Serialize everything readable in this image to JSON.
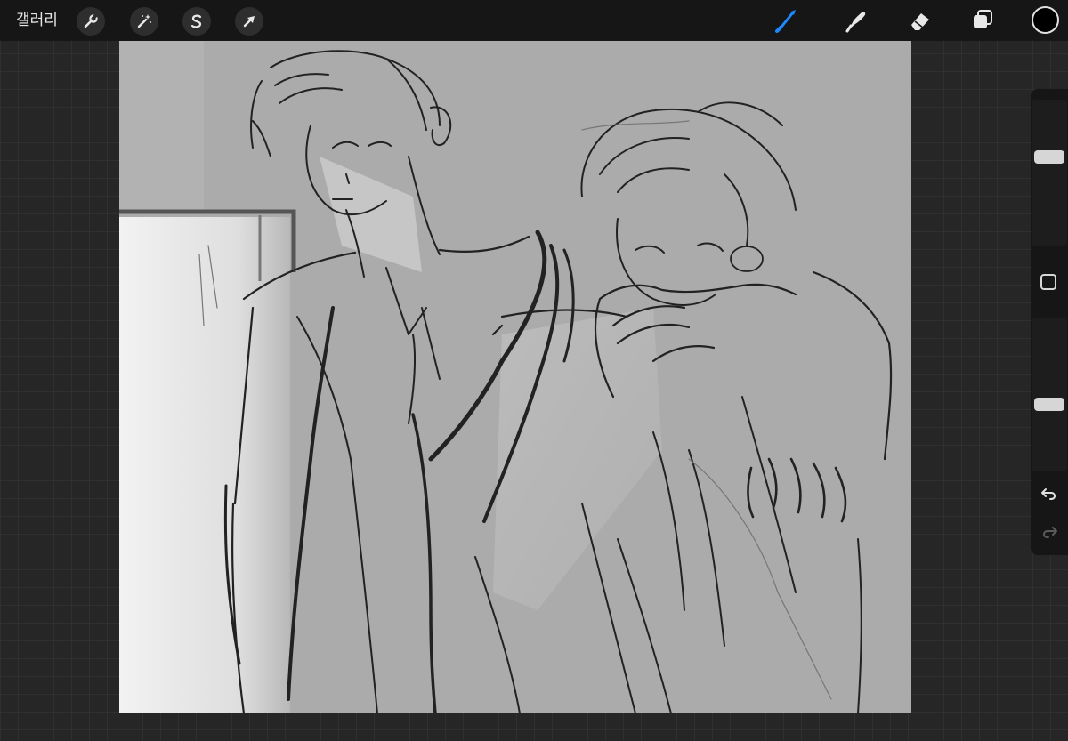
{
  "topbar": {
    "gallery_label": "갤러리",
    "actions_icon": "wrench-icon",
    "adjustments_icon": "magic-wand-icon",
    "selection_icon": "selection-s-icon",
    "transform_icon": "arrow-cursor-icon",
    "brush_icon": "brush-icon",
    "smudge_icon": "smudge-icon",
    "eraser_icon": "eraser-icon",
    "layers_icon": "layers-icon",
    "active_color": "#000000",
    "active_tool_color": "#1e88ff"
  },
  "sidebar": {
    "brush_size_level": 0.62,
    "opacity_level": 0.43,
    "modify_icon": "square-icon",
    "undo_icon": "undo-arrow-icon",
    "redo_icon": "redo-arrow-icon"
  }
}
